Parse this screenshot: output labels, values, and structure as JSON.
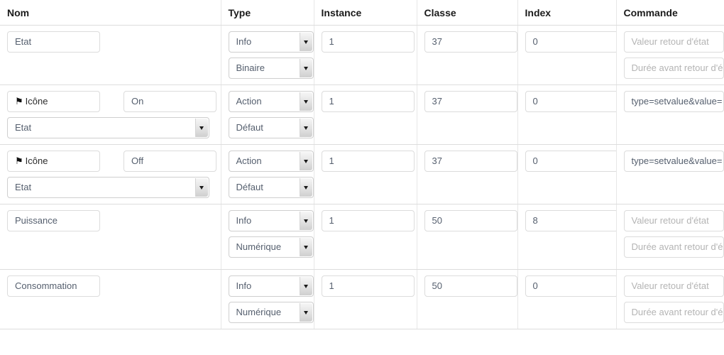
{
  "table": {
    "headers": [
      "Nom",
      "Type",
      "Instance",
      "Classe",
      "Index",
      "Commande"
    ],
    "placeholders": {
      "valeur_retour": "Valeur retour d'état",
      "duree_retour": "Durée avant retour d'é"
    },
    "icon_button_label": "Icône",
    "icon_glyph": "⚑",
    "rows": [
      {
        "kind": "info",
        "nom": "Etat",
        "type_primary": "Info",
        "type_secondary": "Binaire",
        "instance": "1",
        "classe": "37",
        "index": "0",
        "commande_value": "",
        "commande_is_placeholder": true
      },
      {
        "kind": "action",
        "icon_label": "Icône",
        "nom_value": "On",
        "nom_select": "Etat",
        "type_primary": "Action",
        "type_secondary": "Défaut",
        "instance": "1",
        "classe": "37",
        "index": "0",
        "commande_value": "type=setvalue&value=",
        "commande_is_placeholder": false
      },
      {
        "kind": "action",
        "icon_label": "Icône",
        "nom_value": "Off",
        "nom_select": "Etat",
        "type_primary": "Action",
        "type_secondary": "Défaut",
        "instance": "1",
        "classe": "37",
        "index": "0",
        "commande_value": "type=setvalue&value=",
        "commande_is_placeholder": false
      },
      {
        "kind": "info",
        "nom": "Puissance",
        "type_primary": "Info",
        "type_secondary": "Numérique",
        "instance": "1",
        "classe": "50",
        "index": "8",
        "commande_value": "",
        "commande_is_placeholder": true
      },
      {
        "kind": "info",
        "nom": "Consommation",
        "type_primary": "Info",
        "type_secondary": "Numérique",
        "instance": "1",
        "classe": "50",
        "index": "0",
        "commande_value": "",
        "commande_is_placeholder": true
      }
    ]
  },
  "colors": {
    "border": "#dddddd",
    "input_border": "#dcdcdc",
    "text": "#555f6e",
    "placeholder": "#b4b4b4",
    "header_text": "#1a1a1a"
  }
}
